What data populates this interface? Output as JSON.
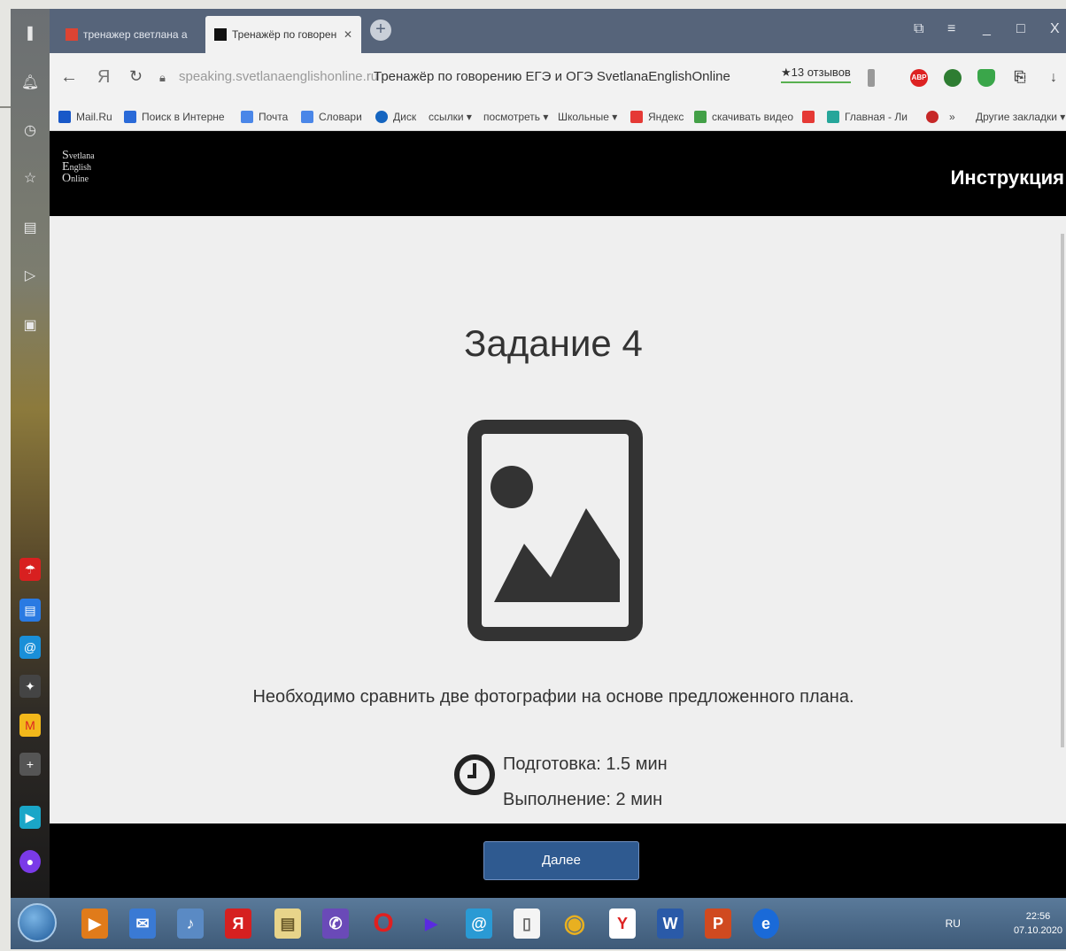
{
  "tabs": [
    {
      "title": "тренажер светлана англ",
      "active": false
    },
    {
      "title": "Тренажёр по говорен",
      "active": true
    }
  ],
  "window_controls": [
    "⧉",
    "≡",
    "_",
    "□",
    "X"
  ],
  "address": {
    "host": "speaking.svetlanaenglishonline.ru",
    "title": "Тренажёр по говорению ЕГЭ и ОГЭ SvetlanaEnglishOnline",
    "reviews": "★13 отзывов"
  },
  "bookmarks": [
    "Mail.Ru",
    "Поиск в Интерне",
    "Почта",
    "Словари",
    "Диск",
    "ссылки ▾",
    "посмотреть ▾",
    "Школьные ▾",
    "Яндекс",
    "скачивать видео",
    "Главная - Ли",
    "»",
    "Другие закладки ▾"
  ],
  "header": {
    "logo_lines": [
      "S",
      "E",
      "O"
    ],
    "logo_sub": [
      "vetlana",
      "nglish",
      "nline"
    ],
    "instruction": "Инструкция"
  },
  "task": {
    "title": "Задание 4",
    "description": "Необходимо сравнить две фотографии на основе предложенного плана.",
    "prep": "Подготовка: 1.5 мин",
    "exec": "Выполнение: 2 мин"
  },
  "footer": {
    "next": "Далее"
  },
  "taskbar": {
    "lang": "RU",
    "time": "22:56",
    "date": "07.10.2020"
  },
  "colors": {
    "accent_button": "#2f5a90",
    "tabbar": "#56647a"
  }
}
